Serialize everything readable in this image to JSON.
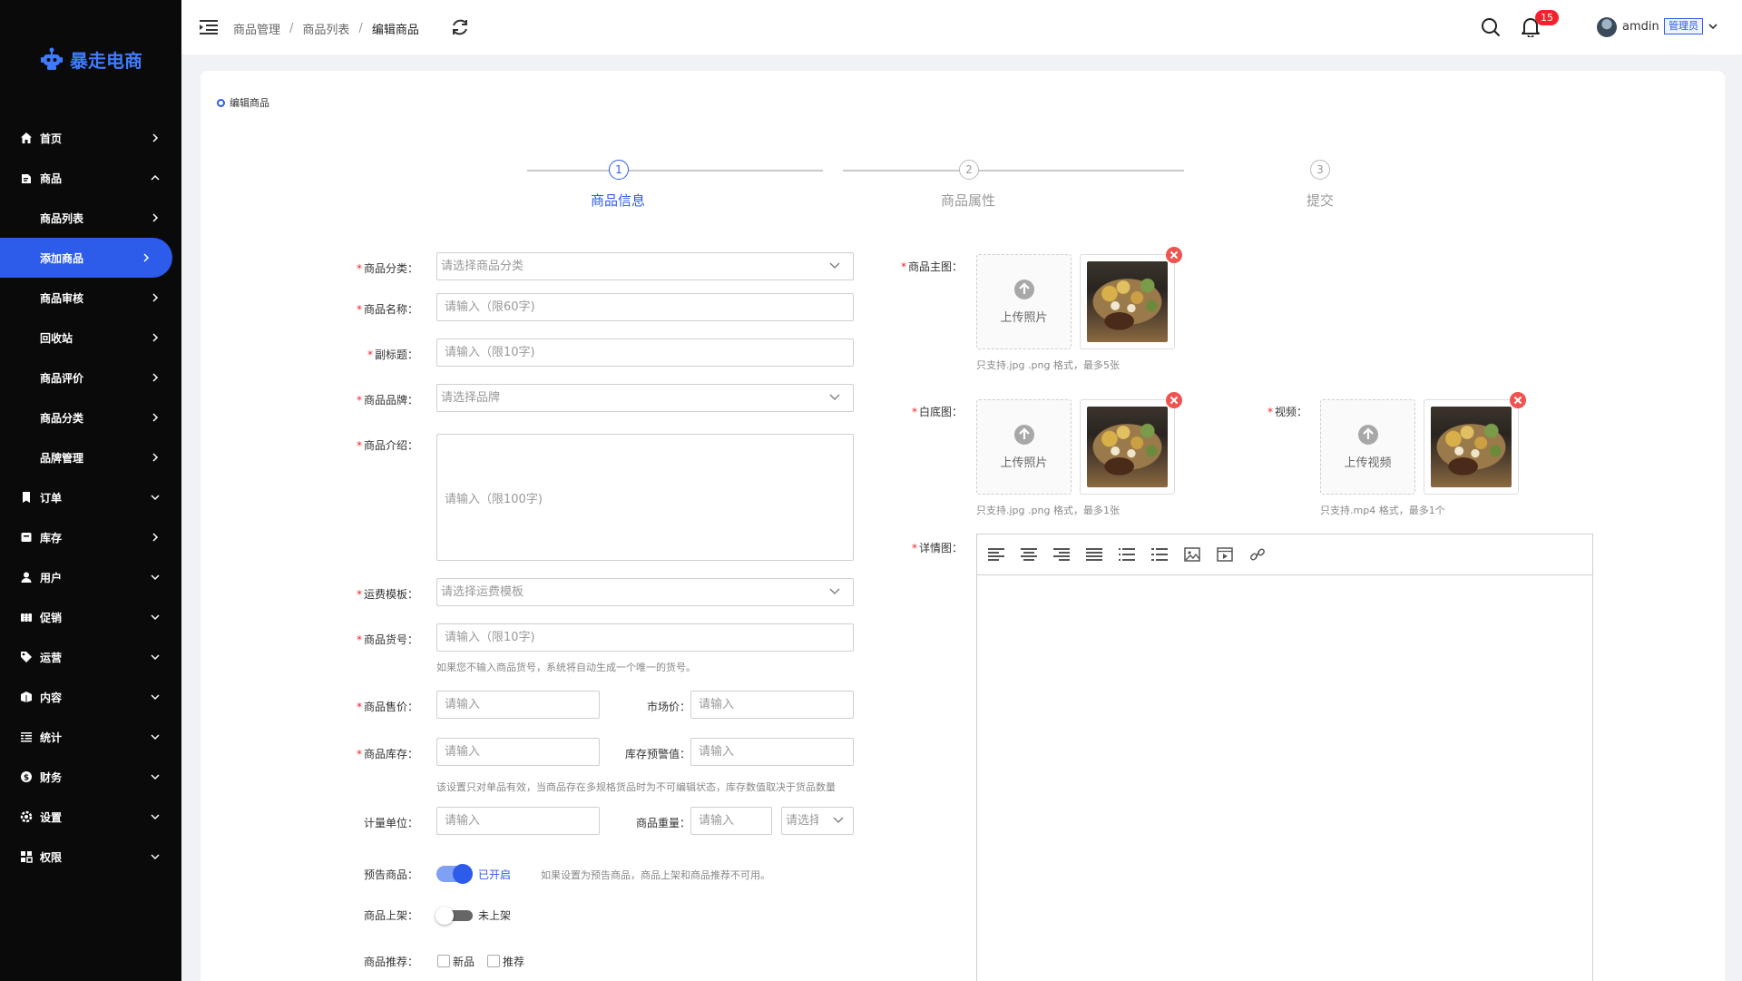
{
  "app": {
    "logo_text": "暴走电商"
  },
  "sidebar": {
    "items": [
      {
        "label": "首页",
        "icon": "home-icon",
        "arrow": "right"
      },
      {
        "label": "商品",
        "icon": "product-icon",
        "arrow": "up"
      },
      {
        "label": "商品列表",
        "sub": true,
        "arrow": "right"
      },
      {
        "label": "添加商品",
        "sub": true,
        "active": true,
        "arrow": "right"
      },
      {
        "label": "商品审核",
        "sub": true,
        "arrow": "right"
      },
      {
        "label": "回收站",
        "sub": true,
        "arrow": "right"
      },
      {
        "label": "商品评价",
        "sub": true,
        "arrow": "right"
      },
      {
        "label": "商品分类",
        "sub": true,
        "arrow": "right"
      },
      {
        "label": "品牌管理",
        "sub": true,
        "arrow": "right"
      },
      {
        "label": "订单",
        "icon": "order-icon",
        "arrow": "down"
      },
      {
        "label": "库存",
        "icon": "inventory-icon",
        "arrow": "right"
      },
      {
        "label": "用户",
        "icon": "user-icon",
        "arrow": "down"
      },
      {
        "label": "促销",
        "icon": "promotion-icon",
        "arrow": "down"
      },
      {
        "label": "运营",
        "icon": "tag-icon",
        "arrow": "down"
      },
      {
        "label": "内容",
        "icon": "content-icon",
        "arrow": "down"
      },
      {
        "label": "统计",
        "icon": "stats-icon",
        "arrow": "down"
      },
      {
        "label": "财务",
        "icon": "finance-icon",
        "arrow": "down"
      },
      {
        "label": "设置",
        "icon": "settings-icon",
        "arrow": "down"
      },
      {
        "label": "权限",
        "icon": "permission-icon",
        "arrow": "down"
      }
    ]
  },
  "header": {
    "breadcrumb": [
      "商品管理",
      "商品列表",
      "编辑商品"
    ],
    "notification_count": "15",
    "username": "amdin",
    "role": "管理员"
  },
  "card": {
    "title": "编辑商品"
  },
  "steps": [
    {
      "num": "1",
      "label": "商品信息",
      "active": true
    },
    {
      "num": "2",
      "label": "商品属性",
      "active": false
    },
    {
      "num": "3",
      "label": "提交",
      "active": false
    }
  ],
  "form": {
    "category": {
      "label": "商品分类：",
      "placeholder": "请选择商品分类"
    },
    "name": {
      "label": "商品名称：",
      "placeholder": "请输入（限60字)"
    },
    "subtitle": {
      "label": "副标题：",
      "placeholder": "请输入（限10字)"
    },
    "brand": {
      "label": "商品品牌：",
      "placeholder": "请选择品牌"
    },
    "intro": {
      "label": "商品介绍：",
      "placeholder": "请输入（限100字)"
    },
    "shipping": {
      "label": "运费模板：",
      "placeholder": "请选择运费模板"
    },
    "sku": {
      "label": "商品货号：",
      "placeholder": "请输入（限10字)",
      "hint": "如果您不输入商品货号，系统将自动生成一个唯一的货号。"
    },
    "price": {
      "label": "商品售价：",
      "placeholder": "请输入"
    },
    "market_price": {
      "label": "市场价：",
      "placeholder": "请输入"
    },
    "stock": {
      "label": "商品库存：",
      "placeholder": "请输入"
    },
    "stock_warn": {
      "label": "库存预警值：",
      "placeholder": "请输入"
    },
    "stock_hint": "该设置只对单品有效，当商品存在多规格货品时为不可编辑状态，库存数值取决于货品数量",
    "unit": {
      "label": "计量单位：",
      "placeholder": "请输入"
    },
    "weight": {
      "label": "商品重量：",
      "placeholder": "请输入",
      "unit_placeholder": "请选择"
    },
    "presale": {
      "label": "预告商品：",
      "state": "已开启",
      "hint": "如果设置为预告商品，商品上架和商品推荐不可用。"
    },
    "onshelf": {
      "label": "商品上架：",
      "state": "未上架"
    },
    "recommend": {
      "label": "商品推荐：",
      "options": [
        "新品",
        "推荐"
      ]
    },
    "main_image": {
      "label": "商品主图：",
      "upload_text": "上传照片",
      "hint": "只支持.jpg .png 格式，最多5张"
    },
    "white_image": {
      "label": "白底图：",
      "upload_text": "上传照片",
      "hint": "只支持.jpg .png 格式，最多1张"
    },
    "video": {
      "label": "视频：",
      "upload_text": "上传视频",
      "hint": "只支持.mp4 格式，最多1个"
    },
    "detail": {
      "label": "详情图："
    }
  },
  "colors": {
    "accent": "#2d5bea",
    "sidebar_bg": "#0a0a0a",
    "required": "#f5222d"
  }
}
